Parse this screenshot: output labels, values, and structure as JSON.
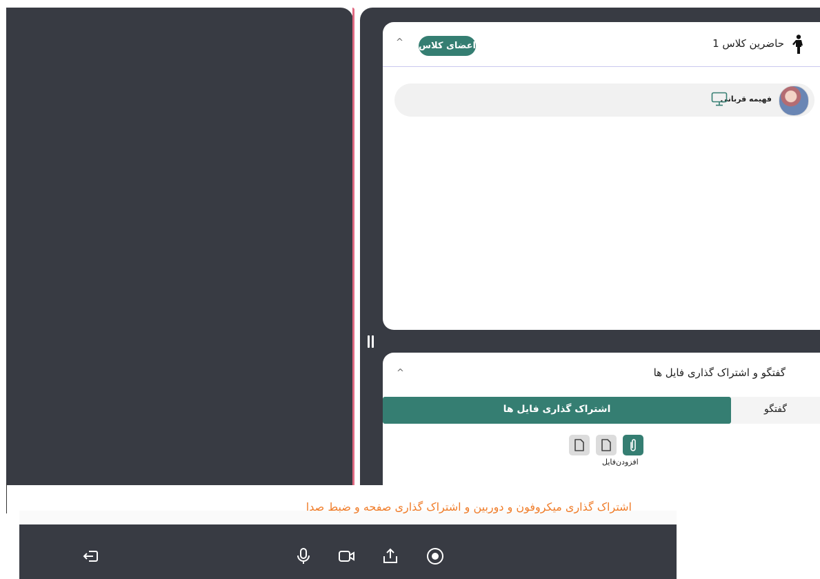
{
  "participants": {
    "title": "حاضرین کلاس 1",
    "members_button": "اعضای کلاس",
    "list": [
      {
        "name": "فهیمه قربانی"
      }
    ]
  },
  "chat": {
    "title": "گفتگو و اشتراک گذاری فایل ها",
    "tabs": {
      "files": "اشتراک گذاری فایل ها",
      "chat": "گفتگو"
    },
    "add_file_label": "افزودن‌فایل"
  },
  "hint": "اشتراک گذاری میکروفون و دوربین و اشتراک گذاری صفحه و ضبط صدا",
  "icons": {
    "person": "standing-person-icon",
    "monitor": "monitor-icon",
    "attach": "paperclip-icon",
    "document": "document-icon",
    "exit": "exit-icon",
    "mic": "microphone-icon",
    "camera": "camera-icon",
    "share": "share-screen-icon",
    "record": "record-icon"
  },
  "colors": {
    "accent": "#357e72",
    "dark": "#383b43",
    "hint": "#f07d2a"
  }
}
